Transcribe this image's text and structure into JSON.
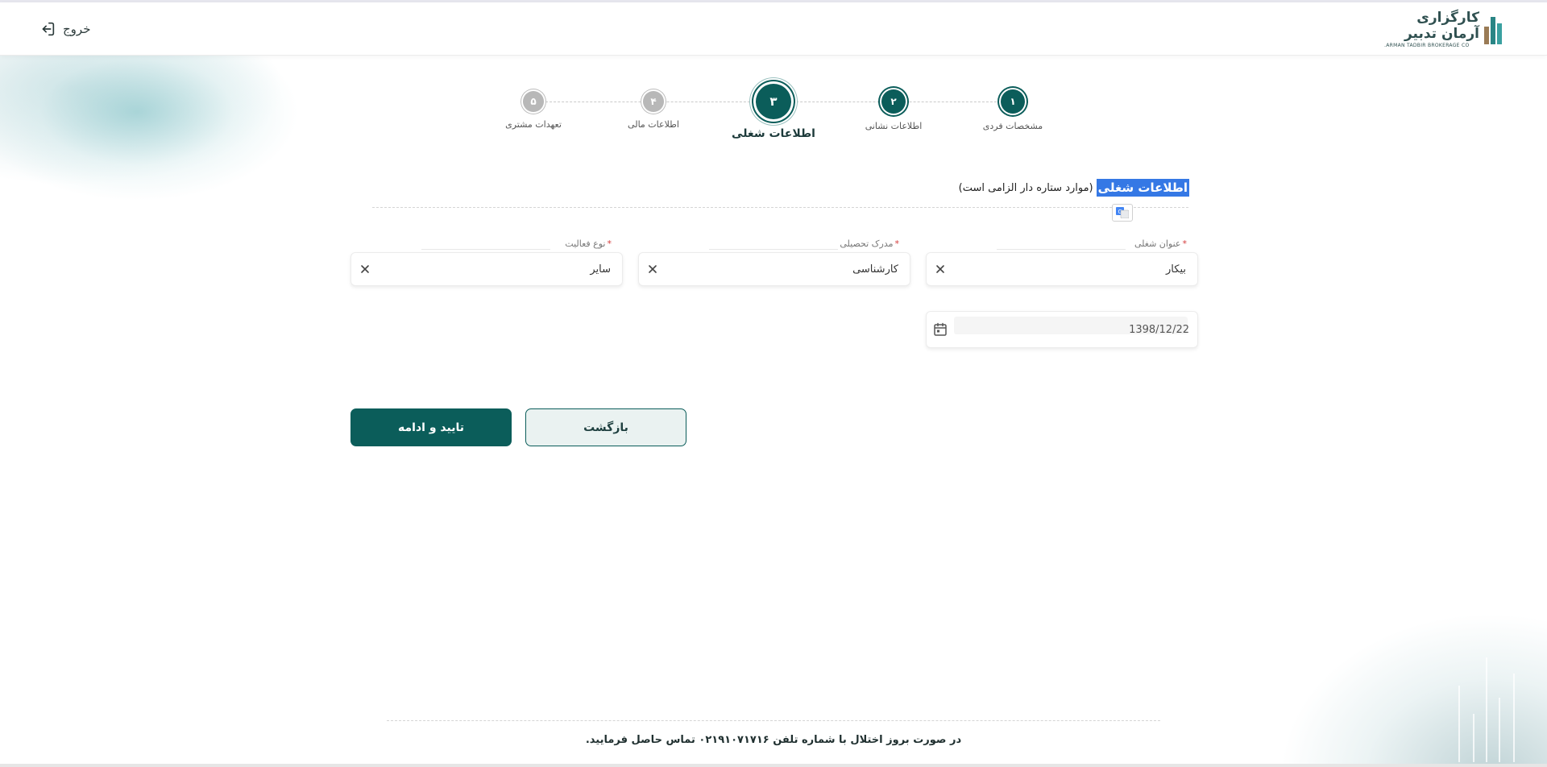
{
  "header": {
    "logout_label": "خروج",
    "logo_text": "کارگزاری آرمان تدبیر",
    "logo_subtext": "ARMAN TADBIR BROKERAGE CO."
  },
  "stepper": {
    "steps": [
      {
        "number": "۱",
        "label": "مشخصات فردی",
        "state": "done"
      },
      {
        "number": "۲",
        "label": "اطلاعات نشانی",
        "state": "done"
      },
      {
        "number": "۳",
        "label": "اطلاعات شغلی",
        "state": "active"
      },
      {
        "number": "۴",
        "label": "اطلاعات مالی",
        "state": "todo"
      },
      {
        "number": "۵",
        "label": "تعهدات مشتری",
        "state": "todo"
      }
    ]
  },
  "section": {
    "title": "اطلاعات شغلی",
    "note": "(موارد ستاره دار الزامی است)"
  },
  "form": {
    "job_title": {
      "label": "عنوان شغلی",
      "required": "*",
      "value": "بیکار"
    },
    "education": {
      "label": "مدرک تحصیلی",
      "required": "*",
      "value": "کارشناسی"
    },
    "activity_type": {
      "label": "نوع فعالیت",
      "required": "*",
      "value": "سایر"
    },
    "date": {
      "value": "1398/12/22"
    }
  },
  "buttons": {
    "confirm": "تایید و ادامه",
    "back": "بازگشت"
  },
  "footer": {
    "text": "در صورت بروز اختلال با شماره تلفن ۰۲۱۹۱۰۷۱۷۱۶ تماس حاصل فرمایید."
  },
  "colors": {
    "primary": "#0b5d5a",
    "required": "#d43b3b",
    "highlight": "#3578e5"
  }
}
